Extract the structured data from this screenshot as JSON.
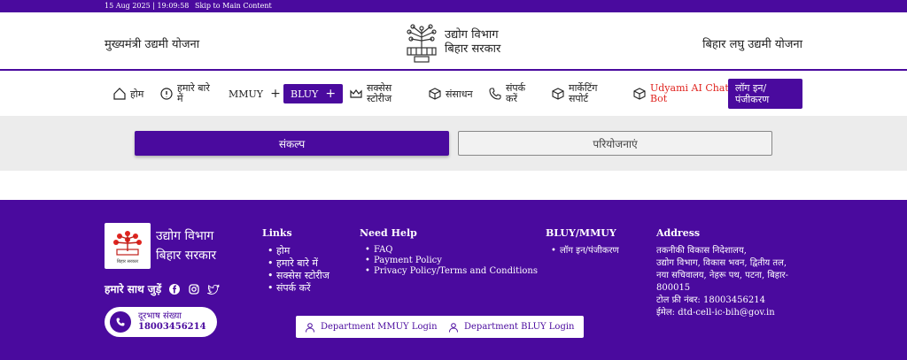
{
  "topbar": {
    "datetime": "15 Aug 2025 | 19:09:58",
    "skip_link": "Skip to Main Content"
  },
  "header": {
    "left_title": "मुख्यमंत्री उद्यमी योजना",
    "dept_line1": "उद्योग विभाग",
    "dept_line2": "बिहार सरकार",
    "right_title": "बिहार लघु उद्यमी योजना",
    "logo_icon": "bihar-emblem-icon"
  },
  "nav": {
    "home": "होम",
    "about_line1": "हमारे बारे",
    "about_line2": "में",
    "mmuy": "MMUY",
    "bluy": "BLUY",
    "success_line1": "सक्सेस",
    "success_line2": "स्टोरीज",
    "resources": "संसाधन",
    "contact_line1": "संपर्क",
    "contact_line2": "करें",
    "marketing_line1": "मार्केटिंग",
    "marketing_line2": "सपोर्ट",
    "ai_line1": "Udyami AI Chat",
    "ai_line2": "Bot",
    "login_line1": "लॉग इन/",
    "login_line2": "पंजीकरण",
    "plus": "+",
    "accent": "#4a0a9e",
    "ai_color": "#e0241f"
  },
  "tabs": {
    "active": "संकल्प",
    "inactive": "परियोजनाएं"
  },
  "footer": {
    "dept_line1": "उद्योग विभाग",
    "dept_line2": "बिहार सरकार",
    "logo_caption": "बिहार सरकार",
    "join_us": "हमारे साथ जुड़ें",
    "phone_label": "दूरभाष संख्या",
    "phone_number": "18003456214",
    "links_title": "Links",
    "links": [
      "होम",
      "हमारे बारे में",
      "सक्सेस स्टोरीज",
      "संपर्क करें"
    ],
    "help_title": "Need Help",
    "help": [
      "FAQ",
      "Payment Policy",
      "Privacy Policy/Terms and Conditions"
    ],
    "bluy_title": "BLUY/MMUY",
    "bluy_items": [
      "लॉग इन/पंजीकरण"
    ],
    "address_title": "Address",
    "address_lines": [
      "तकनीकी विकास निदेशालय,",
      "उद्योग विभाग, विकास भवन, द्वितीय तल,",
      "नया सचिवालय, नेहरू पथ, पटना, बिहार-",
      "800015"
    ],
    "tollfree": "टोल फ्री नंबर: 18003456214",
    "email": "ईमेल: dtd-cell-ic-bih@gov.in",
    "btn_mmuy": "Department MMUY Login",
    "btn_bluy": "Department BLUY Login"
  }
}
